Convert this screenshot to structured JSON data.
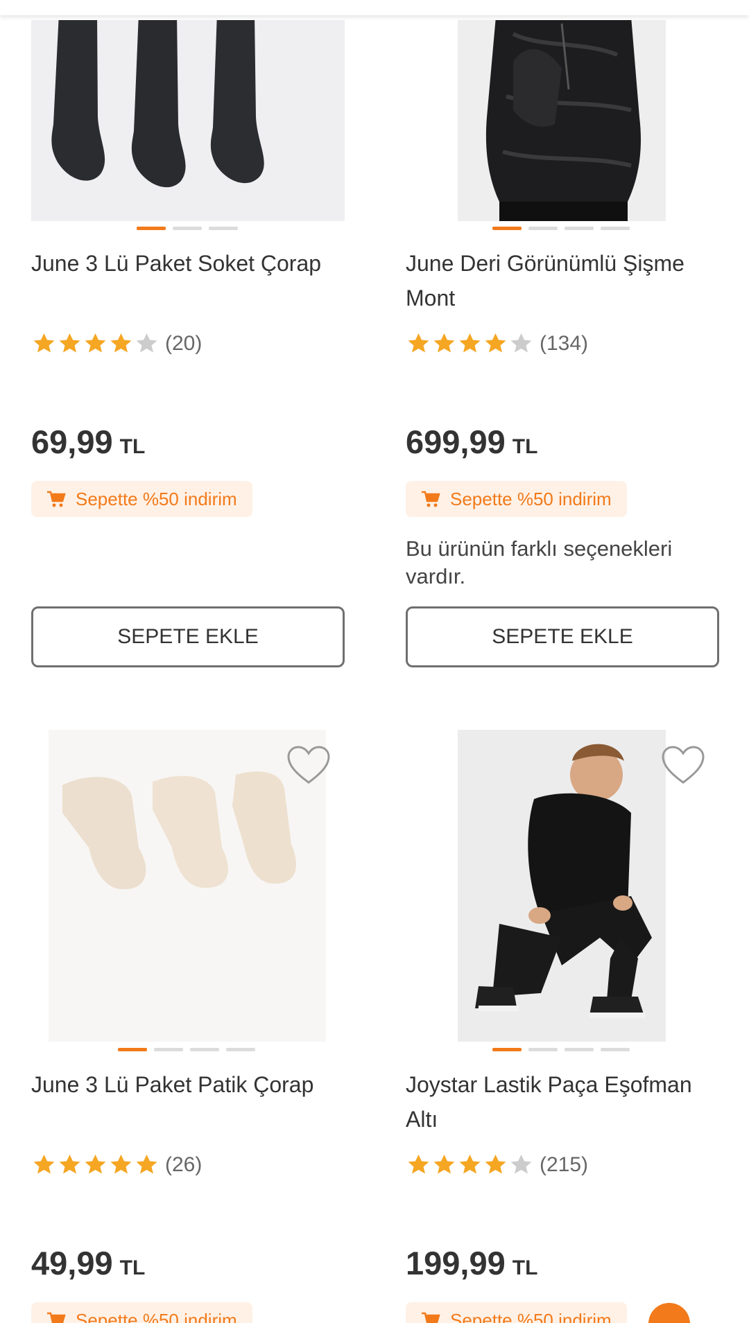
{
  "colors": {
    "accent": "#f27a1a",
    "star_filled": "#f5a623",
    "star_empty": "#cccccc",
    "promo_bg": "#fff1e6",
    "text": "#333333"
  },
  "products": [
    {
      "name": "June 3 Lü Paket Soket Çorap",
      "rating": 4,
      "rating_count": "(20)",
      "price": "69,99",
      "currency": "TL",
      "promo": "Sepette %50 indirim",
      "variant_note": "",
      "add_to_cart": "SEPETE EKLE",
      "image_count": 3,
      "active_image": 1,
      "image_icon": "socks-photo"
    },
    {
      "name": "June Deri Görünümlü Şişme Mont",
      "rating": 4,
      "rating_count": "(134)",
      "price": "699,99",
      "currency": "TL",
      "promo": "Sepette %50 indirim",
      "variant_note": "Bu ürünün farklı seçenekleri vardır.",
      "add_to_cart": "SEPETE EKLE",
      "image_count": 4,
      "active_image": 1,
      "image_icon": "jacket-photo"
    },
    {
      "name": "June 3 Lü Paket Patik Çorap",
      "rating": 5,
      "rating_count": "(26)",
      "price": "49,99",
      "currency": "TL",
      "promo": "Sepette %50 indirim",
      "image_count": 4,
      "active_image": 1,
      "image_icon": "ankle-socks-photo"
    },
    {
      "name": "Joystar Lastik Paça Eşofman Altı",
      "rating": 4,
      "rating_count": "(215)",
      "price": "199,99",
      "currency": "TL",
      "promo": "Sepette %50 indirim",
      "image_count": 4,
      "active_image": 1,
      "image_icon": "tracksuit-photo"
    }
  ]
}
